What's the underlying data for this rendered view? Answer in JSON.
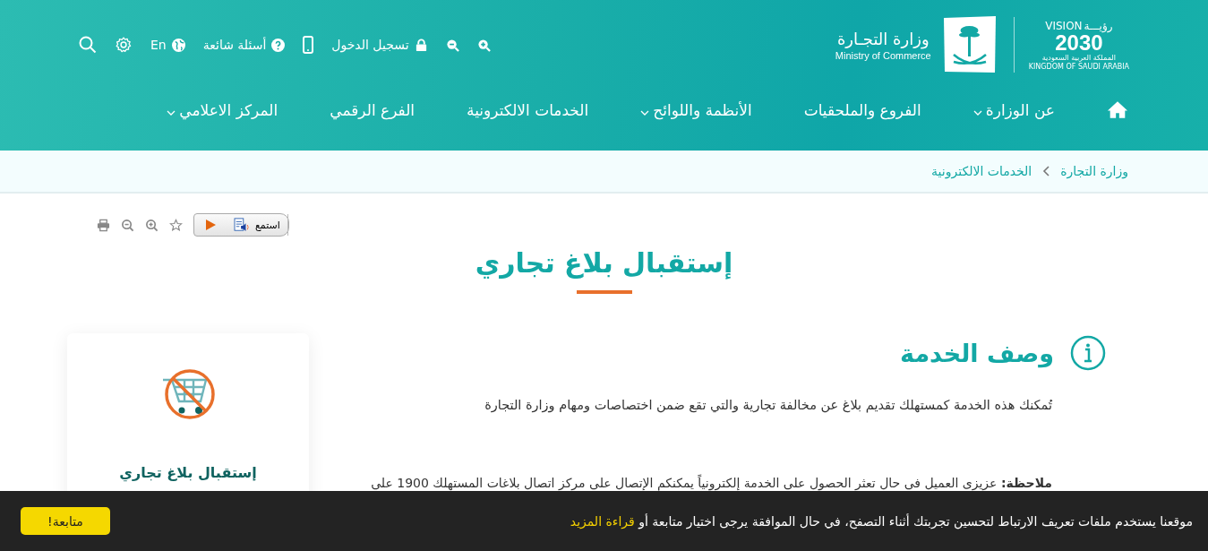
{
  "header": {
    "logo": {
      "arabic": "وزارة التجـارة",
      "english": "Ministry of Commerce"
    },
    "vision": {
      "vision_word": "VISION",
      "vision_arabic": "رؤيـــة",
      "year": "2030",
      "kingdom_arabic": "المملكة العربية السعودية",
      "kingdom_english": "KINGDOM OF SAUDI ARABIA"
    },
    "utilities": [
      {
        "kind": "zoom-in"
      },
      {
        "kind": "zoom-out"
      },
      {
        "kind": "login",
        "label": "تسجيل الدخول"
      },
      {
        "kind": "mobile"
      },
      {
        "kind": "faq",
        "label": "أسئلة شائعة"
      },
      {
        "kind": "language",
        "label": "En"
      },
      {
        "kind": "settings"
      },
      {
        "kind": "search"
      }
    ],
    "nav": [
      {
        "kind": "home"
      },
      {
        "label": "عن الوزارة",
        "expanded": false
      },
      {
        "label": "الفروع والملحقيات"
      },
      {
        "label": "الأنظمة واللوائح",
        "expanded": false
      },
      {
        "label": "الخدمات الالكترونية"
      },
      {
        "label": "الفرع الرقمي"
      },
      {
        "label": "المركز الاعلامي",
        "expanded": false
      }
    ]
  },
  "breadcrumb": [
    "وزارة التجارة",
    "الخدمات الالكترونية"
  ],
  "tools": {
    "listen": "استمع"
  },
  "title": "إستقبال بلاغ تجاري",
  "description": {
    "heading": "وصف الخدمة",
    "text": "تُمكنك هذه الخدمة كمستهلك تقديم بلاغ عن مخالفة تجارية والتي تقع ضمن اختصاصات ومهام وزارة التجارة",
    "note": "**ملاحظة:** عزيزى العميل فى حال تعثر الحصول على الخدمة إلكترونياً يمكنكم الإتصال على مركز اتصال بلاغات المستهلك 1900 على"
  },
  "service_card": {
    "title": "إستقبال بلاغ تجاري"
  },
  "cookie_bar": {
    "text": "موقعنا يستخدم ملفات تعريف الارتباط لتحسين تجربتك أثناء التصفح، في حال الموافقة يرجى اختيار متابعة أو",
    "link": "قراءة المزيد",
    "button": "متابعة!"
  }
}
